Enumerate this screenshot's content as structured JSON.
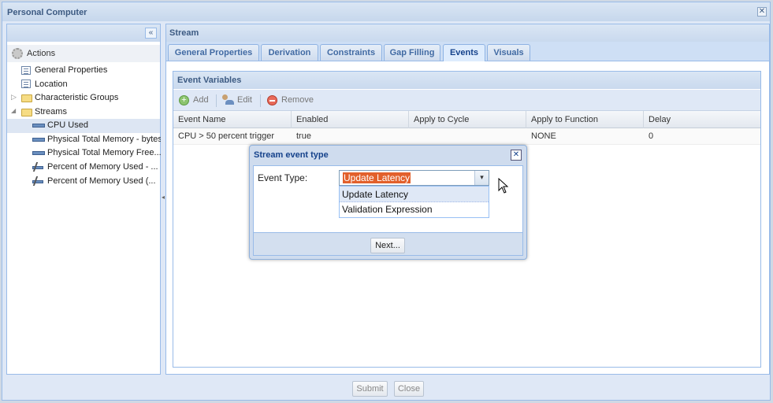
{
  "window": {
    "title": "Personal Computer",
    "close_glyph": "✕"
  },
  "left_panel": {
    "collapse_glyph": "«",
    "actions_label": "Actions",
    "tree": [
      {
        "label": "General Properties",
        "icon": "properties-icon",
        "expander": ""
      },
      {
        "label": "Location",
        "icon": "properties-icon",
        "expander": ""
      },
      {
        "label": "Characteristic Groups",
        "icon": "folder-icon",
        "expander": "▷"
      },
      {
        "label": "Streams",
        "icon": "folder-icon",
        "expander": "◢"
      },
      {
        "label": "CPU Used",
        "icon": "stream-icon",
        "selected": true
      },
      {
        "label": "Physical Total Memory - bytes",
        "icon": "stream-icon"
      },
      {
        "label": "Physical Total Memory Free...",
        "icon": "stream-icon"
      },
      {
        "label": "Percent of Memory Used - ...",
        "icon": "derived-stream-icon"
      },
      {
        "label": "Percent of Memory Used (...",
        "icon": "derived-stream-icon"
      }
    ]
  },
  "stream_panel": {
    "title": "Stream",
    "tabs": [
      "General Properties",
      "Derivation",
      "Constraints",
      "Gap Filling",
      "Events",
      "Visuals"
    ],
    "active_tab": "Events",
    "section_title": "Event Variables",
    "toolbar": {
      "add": "Add",
      "edit": "Edit",
      "remove": "Remove"
    },
    "columns": [
      "Event Name",
      "Enabled",
      "Apply to Cycle",
      "Apply to Function",
      "Delay"
    ],
    "rows": [
      {
        "event_name": "CPU > 50 percent trigger",
        "enabled": "true",
        "apply_to_cycle": "",
        "apply_to_function": "NONE",
        "delay": "0"
      }
    ]
  },
  "dialog": {
    "title": "Stream event type",
    "close_glyph": "✕",
    "field_label": "Event Type:",
    "selected_value": "Update Latency",
    "trigger_glyph": "▾",
    "options": [
      "Update Latency",
      "Validation Expression"
    ],
    "next_button": "Next..."
  },
  "footer": {
    "submit": "Submit",
    "close": "Close"
  }
}
